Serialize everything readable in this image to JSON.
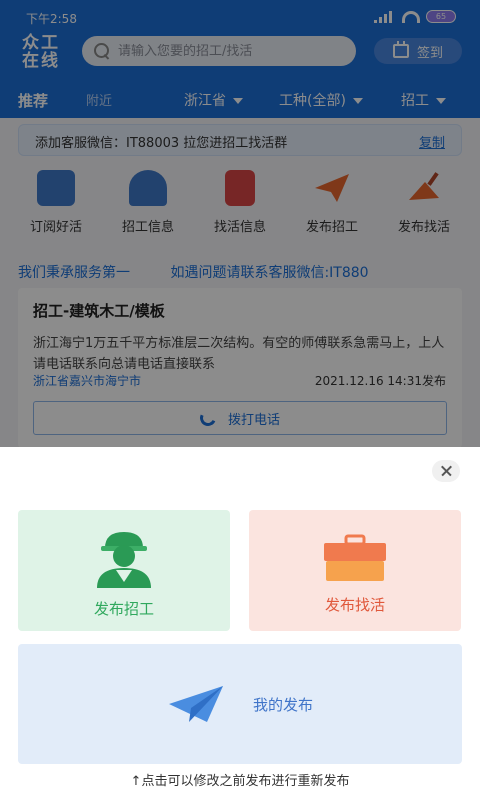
{
  "status_bar": {
    "time": "下午2:58",
    "battery": "65"
  },
  "header": {
    "logo_line1": "众工",
    "logo_line2": "在线",
    "search_placeholder": "请输入您要的招工/找活",
    "signin_label": "签到"
  },
  "filters": {
    "tab_recommend": "推荐",
    "tab_nearby": "附近",
    "province": "浙江省",
    "trade": "工种(全部)",
    "type": "招工"
  },
  "notice": {
    "text": "添加客服微信：IT88003 拉您进招工找活群",
    "copy_label": "复制"
  },
  "quick_links": [
    {
      "label": "订阅好活",
      "icon": "briefcase-icon"
    },
    {
      "label": "招工信息",
      "icon": "worker-icon"
    },
    {
      "label": "找活信息",
      "icon": "document-icon"
    },
    {
      "label": "发布招工",
      "icon": "paper-plane-icon"
    },
    {
      "label": "发布找活",
      "icon": "trowel-icon"
    }
  ],
  "marquee": {
    "text1": "我们秉承服务第一",
    "text2": "如遇问题请联系客服微信:IT880"
  },
  "job_card": {
    "title": "招工-建筑木工/模板",
    "description": "浙江海宁1万五千平方标准层二次结构。有空的师傅联系急需马上，上人请电话联系向总请电话直接联系",
    "location": "浙江省嘉兴市海宁市",
    "date": "2021.12.16 14:31发布",
    "call_label": "拨打电话"
  },
  "sheet": {
    "recruit_label": "发布招工",
    "find_work_label": "发布找活",
    "my_posts_label": "我的发布",
    "hint": "↑点击可以修改之前发布进行重新发布"
  },
  "colors": {
    "primary": "#1d6fd8",
    "green": "#2fa85d",
    "orange": "#e0583b"
  }
}
